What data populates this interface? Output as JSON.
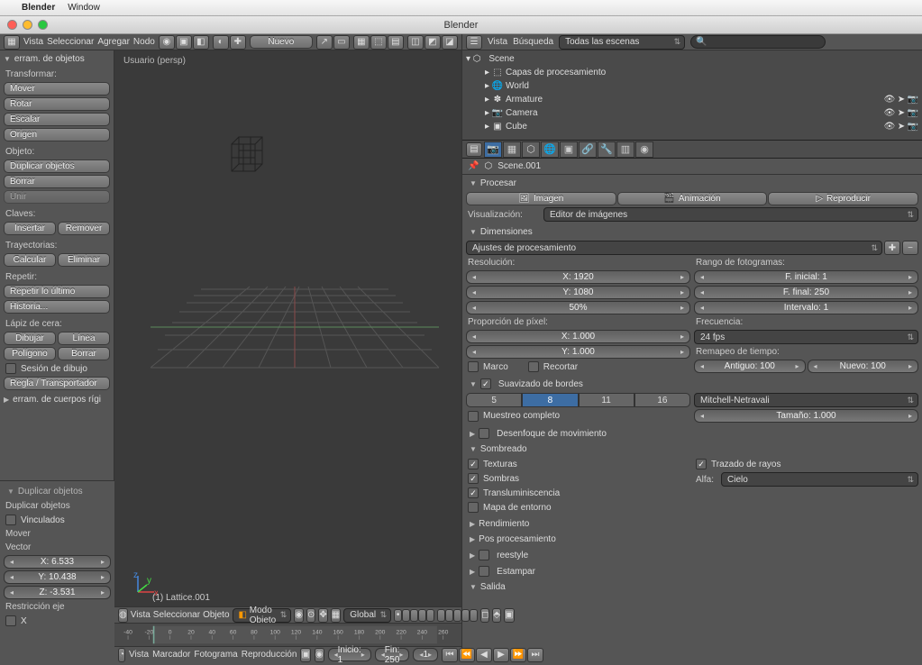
{
  "mac": {
    "menu_blender": "Blender",
    "menu_window": "Window",
    "window_title": "Blender"
  },
  "topbar": {
    "menus": [
      "Vista",
      "Seleccionar",
      "Agregar",
      "Nodo"
    ],
    "nuevo": "Nuevo"
  },
  "toolshelf": {
    "hdr_tools": "erram. de objetos",
    "transformar": "Transformar:",
    "mover": "Mover",
    "rotar": "Rotar",
    "escalar": "Escalar",
    "origen": "Origen",
    "objeto": "Objeto:",
    "duplicar": "Duplicar objetos",
    "borrar": "Borrar",
    "unir": "Unir",
    "claves": "Claves:",
    "insertar": "Insertar",
    "remover": "Remover",
    "trayectorias": "Trayectorias:",
    "calcular": "Calcular",
    "eliminar": "Eliminar",
    "repetir": "Repetir:",
    "repetir_ultimo": "Repetir lo último",
    "historia": "Historia...",
    "lapiz": "Lápiz de cera:",
    "dibujar": "Dibujar",
    "linea": "Línea",
    "poligono": "Polígono",
    "borrar2": "Borrar",
    "sesion": "Sesión de dibujo",
    "regla": "Regla / Transportador",
    "hdr_rigid": "erram. de cuerpos rígi"
  },
  "operator_panel": {
    "hdr": "Duplicar objetos",
    "duplicar": "Duplicar objetos",
    "vinculados": "Vinculados",
    "mover": "Mover",
    "vector": "Vector",
    "x": "X: 6.533",
    "y": "Y: 10.438",
    "z": "Z: -3.531",
    "restriccion": "Restricción eje",
    "rx": "X"
  },
  "viewport": {
    "label": "Usuario (persp)",
    "active_obj": "(1) Lattice.001",
    "footer_menus": [
      "Vista",
      "Seleccionar",
      "Objeto"
    ],
    "mode": "Modo Objeto",
    "orient": "Global"
  },
  "timeline": {
    "ticks": [
      -40,
      -20,
      0,
      20,
      40,
      60,
      80,
      100,
      120,
      140,
      160,
      180,
      200,
      220,
      240,
      260
    ],
    "menus": [
      "Vista",
      "Marcador",
      "Fotograma",
      "Reproducción"
    ],
    "inicio": "Inicio: 1",
    "fin": "Fin: 250",
    "cur": "1"
  },
  "outliner": {
    "menus": [
      "Vista",
      "Búsqueda"
    ],
    "filter": "Todas las escenas",
    "root": "Scene",
    "items": [
      {
        "icon": "⬚",
        "label": "Capas de procesamiento",
        "indent": 1
      },
      {
        "icon": "🌐",
        "label": "World",
        "indent": 1
      },
      {
        "icon": "✽",
        "label": "Armature",
        "indent": 1,
        "vis": true
      },
      {
        "icon": "📷",
        "label": "Camera",
        "indent": 1,
        "vis": true
      },
      {
        "icon": "▣",
        "label": "Cube",
        "indent": 1,
        "vis": true
      }
    ]
  },
  "scene_name": "Scene.001",
  "render": {
    "hdr_procesar": "Procesar",
    "imagen": "Imagen",
    "animacion": "Animación",
    "reproducir": "Reproducir",
    "visualizacion": "Visualización:",
    "visualizacion_val": "Editor de imágenes",
    "hdr_dim": "Dimensiones",
    "preset": "Ajustes de procesamiento",
    "resolucion": "Resolución:",
    "resx": "X: 1920",
    "resy": "Y: 1080",
    "respct": "50%",
    "rango": "Rango de fotogramas:",
    "finicial": "F. inicial: 1",
    "ffinal": "F. final: 250",
    "intervalo": "Intervalo: 1",
    "proporcion": "Proporción de píxel:",
    "px": "X: 1.000",
    "py": "Y: 1.000",
    "frecuencia": "Frecuencia:",
    "fps": "24 fps",
    "remapeo": "Remapeo de tiempo:",
    "antiguo": "Antiguo: 100",
    "nuevo": "Nuevo: 100",
    "marco": "Marco",
    "recortar": "Recortar",
    "hdr_aa": "Suavizado de bordes",
    "aa_opts": [
      "5",
      "8",
      "11",
      "16"
    ],
    "aa_active": "8",
    "aa_filter": "Mitchell-Netravali",
    "muestreo": "Muestreo completo",
    "tamano": "Tamaño: 1.000",
    "hdr_mb": "Desenfoque de movimiento",
    "hdr_shading": "Sombreado",
    "texturas": "Texturas",
    "sombras": "Sombras",
    "transluminiscencia": "Transluminiscencia",
    "mapa_entorno": "Mapa de entorno",
    "trazado": "Trazado de rayos",
    "alfa": "Alfa:",
    "alfa_val": "Cielo",
    "hdr_perf": "Rendimiento",
    "hdr_post": "Pos procesamiento",
    "reestyle": "reestyle",
    "estampar": "Estampar",
    "hdr_salida": "Salida"
  }
}
